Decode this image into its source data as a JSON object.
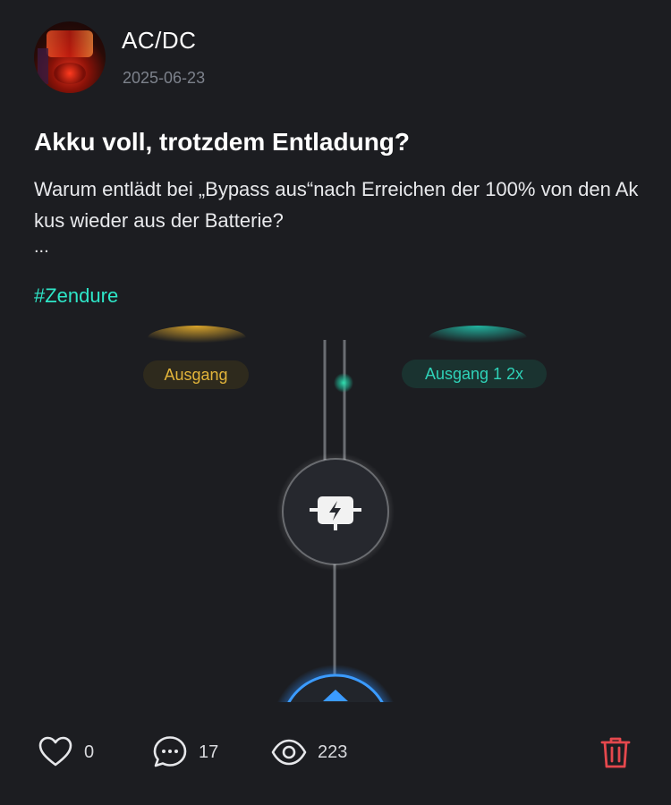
{
  "author": {
    "name": "AC/DC",
    "date": "2025-06-23"
  },
  "post": {
    "title": "Akku voll, trotzdem Entladung?",
    "body": "Warum entlädt bei „Bypass aus“nach Erreichen der 100% von den Akkus wieder aus der Batterie?",
    "ellipsis": "...",
    "hashtag": "#Zendure"
  },
  "image": {
    "label_left": "Ausgang",
    "label_right": "Ausgang 1 2x",
    "center_icon": "battery-charge-icon",
    "bottom_icon": "house-icon"
  },
  "footer": {
    "likes": "0",
    "comments": "17",
    "views": "223"
  },
  "colors": {
    "background": "#1c1d21",
    "accent_teal": "#2ee6c8",
    "accent_yellow": "#e2b43a",
    "delete_red": "#e5484d",
    "glow_blue": "#2f8fff"
  }
}
